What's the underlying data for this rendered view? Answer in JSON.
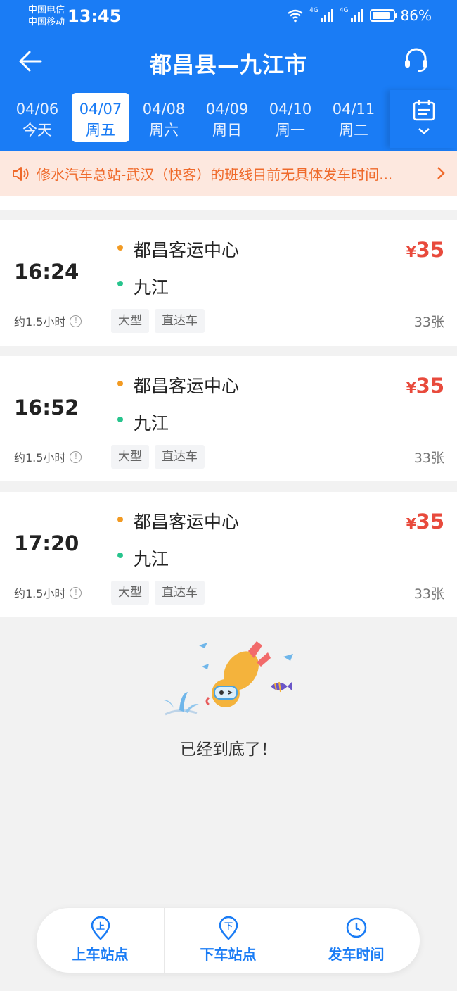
{
  "status_bar": {
    "carrier1": "中国电信",
    "carrier2": "中国移动",
    "time": "13:45",
    "network1": "4G",
    "network2": "4G",
    "battery": "86%",
    "battery_level": 0.86
  },
  "header": {
    "title": "都昌县—九江市"
  },
  "dates": [
    {
      "date": "04/06",
      "weekday": "今天",
      "active": false
    },
    {
      "date": "04/07",
      "weekday": "周五",
      "active": true
    },
    {
      "date": "04/08",
      "weekday": "周六",
      "active": false
    },
    {
      "date": "04/09",
      "weekday": "周日",
      "active": false
    },
    {
      "date": "04/10",
      "weekday": "周一",
      "active": false
    },
    {
      "date": "04/11",
      "weekday": "周二",
      "active": false
    }
  ],
  "notice": {
    "text": "修水汽车总站-武汉（快客）的班线目前无具体发车时间..."
  },
  "trips": [
    {
      "time": "16:24",
      "from": "都昌客运中心",
      "to": "九江",
      "price_symbol": "¥",
      "price": "35",
      "duration": "约1.5小时",
      "tags": [
        "大型",
        "直达车"
      ],
      "tickets": "33张"
    },
    {
      "time": "16:52",
      "from": "都昌客运中心",
      "to": "九江",
      "price_symbol": "¥",
      "price": "35",
      "duration": "约1.5小时",
      "tags": [
        "大型",
        "直达车"
      ],
      "tickets": "33张"
    },
    {
      "time": "17:20",
      "from": "都昌客运中心",
      "to": "九江",
      "price_symbol": "¥",
      "price": "35",
      "duration": "约1.5小时",
      "tags": [
        "大型",
        "直达车"
      ],
      "tickets": "33张"
    }
  ],
  "end_message": "已经到底了！",
  "bottom_nav": [
    {
      "label": "上车站点",
      "icon_char": "上",
      "icon": "pickup-location-icon"
    },
    {
      "label": "下车站点",
      "icon_char": "下",
      "icon": "dropoff-location-icon"
    },
    {
      "label": "发车时间",
      "icon_char": "",
      "icon": "clock-icon"
    }
  ],
  "colors": {
    "primary": "#1a7cf5",
    "price": "#e84a3c",
    "notice_text": "#ef6a2b",
    "notice_bg": "#fde8df"
  }
}
